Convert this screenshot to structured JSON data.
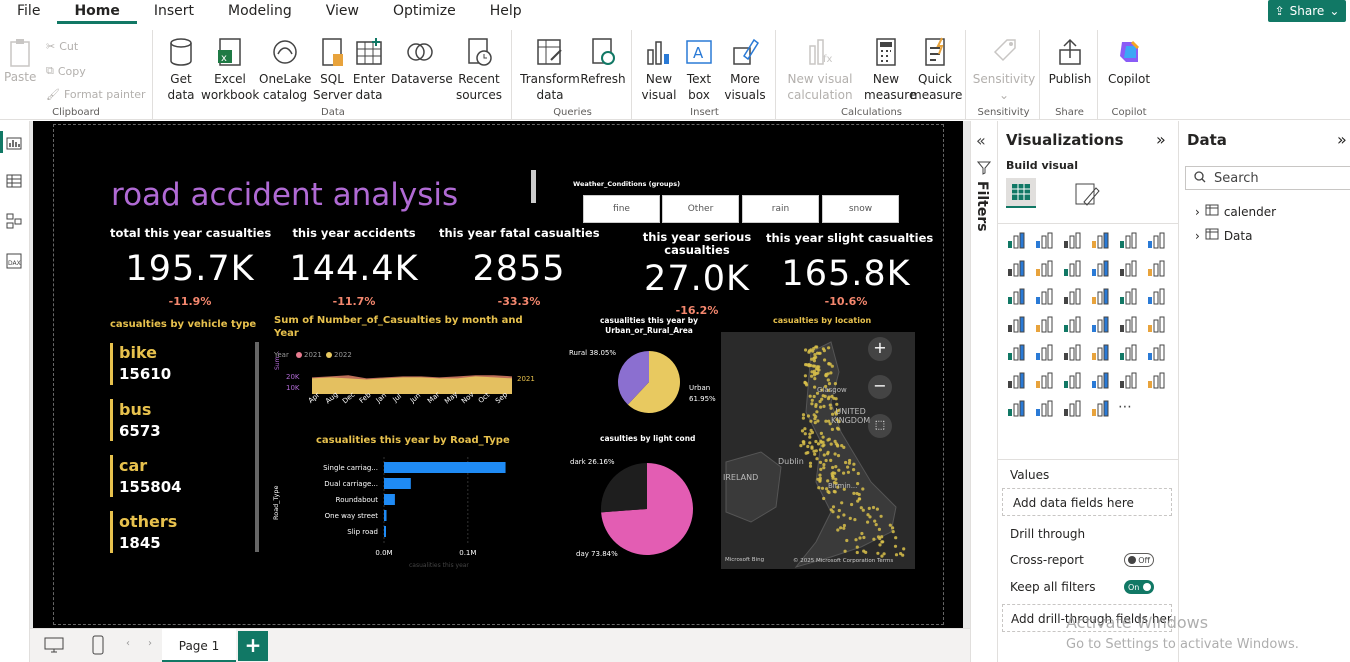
{
  "menu": {
    "items": [
      "File",
      "Home",
      "Insert",
      "Modeling",
      "View",
      "Optimize",
      "Help"
    ],
    "share": "Share"
  },
  "ribbon": {
    "clipboard": {
      "paste": "Paste",
      "cut": "Cut",
      "copy": "Copy",
      "format_painter": "Format painter",
      "label": "Clipboard"
    },
    "data": {
      "get_data": "Get\ndata",
      "excel": "Excel\nworkbook",
      "onelake": "OneLake\ncatalog",
      "sql": "SQL\nServer",
      "enter": "Enter\ndata",
      "dataverse": "Dataverse",
      "recent": "Recent\nsources",
      "label": "Data"
    },
    "queries": {
      "transform": "Transform\ndata",
      "refresh": "Refresh",
      "label": "Queries"
    },
    "insert": {
      "new_visual": "New\nvisual",
      "text_box": "Text\nbox",
      "more_visuals": "More\nvisuals",
      "label": "Insert"
    },
    "calculations": {
      "new_visual_calc": "New visual\ncalculation",
      "new_measure": "New\nmeasure",
      "quick_measure": "Quick\nmeasure",
      "label": "Calculations"
    },
    "sensitivity": {
      "sensitivity": "Sensitivity",
      "label": "Sensitivity"
    },
    "share": {
      "publish": "Publish",
      "label": "Share"
    },
    "copilot": {
      "copilot": "Copilot",
      "label": "Copilot"
    }
  },
  "colors": {
    "accent": "#117865",
    "canvas": "#000000",
    "title": "#b06ad4",
    "yellow": "#e7c14d",
    "pct": "#f4876e",
    "bar": "#1f8bf5",
    "pie_urban": "#e8c960",
    "pie_rural": "#8b6fd0",
    "pie_day": "#e35db3",
    "pie_dark": "#1e1e1e"
  },
  "report": {
    "title": "road accident analysis",
    "cards": [
      {
        "title": "total this year casualties",
        "value": "195.7K",
        "pct": "-11.9%"
      },
      {
        "title": "this year accidents",
        "value": "144.4K",
        "pct": "-11.7%"
      },
      {
        "title": "this year fatal casualties",
        "value": "2855",
        "pct": "-33.3%"
      },
      {
        "title": "this year serious\ncasualties",
        "value": "27.0K",
        "pct": "-16.2%"
      },
      {
        "title": "this year slight casualties",
        "value": "165.8K",
        "pct": "-10.6%"
      }
    ],
    "slicer": {
      "title": "Weather_Conditions (groups)",
      "options": [
        "fine",
        "Other",
        "rain",
        "snow"
      ]
    },
    "vehicle": {
      "title": "casualties by vehicle type",
      "items": [
        {
          "name": "bike",
          "value": "15610"
        },
        {
          "name": "bus",
          "value": "6573"
        },
        {
          "name": "car",
          "value": "155804"
        },
        {
          "name": "others",
          "value": "1845"
        }
      ]
    },
    "area_chart": {
      "title": "Sum of Number_of_Casualties by month and\nYear",
      "legend_label": "Year",
      "legend": [
        "2021",
        "2022"
      ],
      "ylabel": "Sum...",
      "yticks": [
        "20K",
        "10K"
      ],
      "end_label": "2021",
      "months": [
        "Apr",
        "Aug",
        "Dec",
        "Feb",
        "Jan",
        "Jul",
        "Jun",
        "Mar",
        "May",
        "Nov",
        "Oct",
        "Sep"
      ]
    },
    "bar_chart": {
      "title": "casualities this year by Road_Type",
      "ylabel": "Road_Type",
      "xlabel": "casualities this year",
      "xticks": [
        "0.0M",
        "0.1M"
      ]
    },
    "pie1": {
      "title": "casualities this year by\nUrban_or_Rural_Area",
      "rural_label": "Rural 38.05%",
      "urban_label": "Urban\n61.95%"
    },
    "pie2": {
      "title": "casulties by light cond",
      "dark_label": "dark 26.16%",
      "day_label": "day 73.84%"
    },
    "map": {
      "title": "casualties by location",
      "labels": [
        "UNITED\nKINGDOM",
        "IRELAND",
        "Dublin",
        "Glasgow",
        "Birmin..."
      ],
      "attribution": "© 2025 Microsoft Corporation  Terms",
      "bing": "Microsoft Bing"
    }
  },
  "chart_data": [
    {
      "type": "bar",
      "title": "casualities this year by Road_Type",
      "categories": [
        "Single carriag...",
        "Dual carriage...",
        "Roundabout",
        "One way street",
        "Slip road"
      ],
      "values": [
        0.145,
        0.032,
        0.013,
        0.003,
        0.002
      ],
      "xlabel": "casualities this year",
      "ylabel": "Road_Type",
      "xlim": [
        0,
        0.17
      ]
    },
    {
      "type": "pie",
      "title": "casualities this year by\nUrban_or_Rural_Area",
      "categories": [
        "Urban",
        "Rural"
      ],
      "values": [
        61.95,
        38.05
      ]
    },
    {
      "type": "pie",
      "title": "casulties by light cond",
      "categories": [
        "day",
        "dark"
      ],
      "values": [
        73.84,
        26.16
      ]
    },
    {
      "type": "area",
      "title": "Sum of Number_of_Casualties by month and\nYear",
      "categories": [
        "Apr",
        "Aug",
        "Dec",
        "Feb",
        "Jan",
        "Jul",
        "Jun",
        "Mar",
        "May",
        "Nov",
        "Oct",
        "Sep"
      ],
      "series": [
        {
          "name": "2021",
          "values": [
            16,
            17,
            18,
            15,
            16,
            17,
            17,
            16,
            17,
            18,
            18,
            17
          ]
        },
        {
          "name": "2022",
          "values": [
            15,
            16,
            15,
            14,
            15,
            16,
            16,
            15,
            15,
            17,
            16,
            15
          ]
        }
      ],
      "ylim": [
        0,
        25
      ]
    }
  ],
  "panels": {
    "filters": "Filters",
    "viz": {
      "title": "Visualizations",
      "build": "Build visual",
      "values": "Values",
      "add_fields": "Add data fields here",
      "drill": "Drill through",
      "cross_report": "Cross-report",
      "cross_state": "Off",
      "keep_filters": "Keep all filters",
      "keep_state": "On",
      "add_drill": "Add drill-through fields here"
    },
    "data": {
      "title": "Data",
      "search": "Search",
      "tables": [
        "calender",
        "Data"
      ]
    }
  },
  "page": {
    "tab": "Page 1",
    "add": "+"
  },
  "watermark": {
    "line1": "Activate Windows",
    "line2": "Go to Settings to activate Windows."
  }
}
